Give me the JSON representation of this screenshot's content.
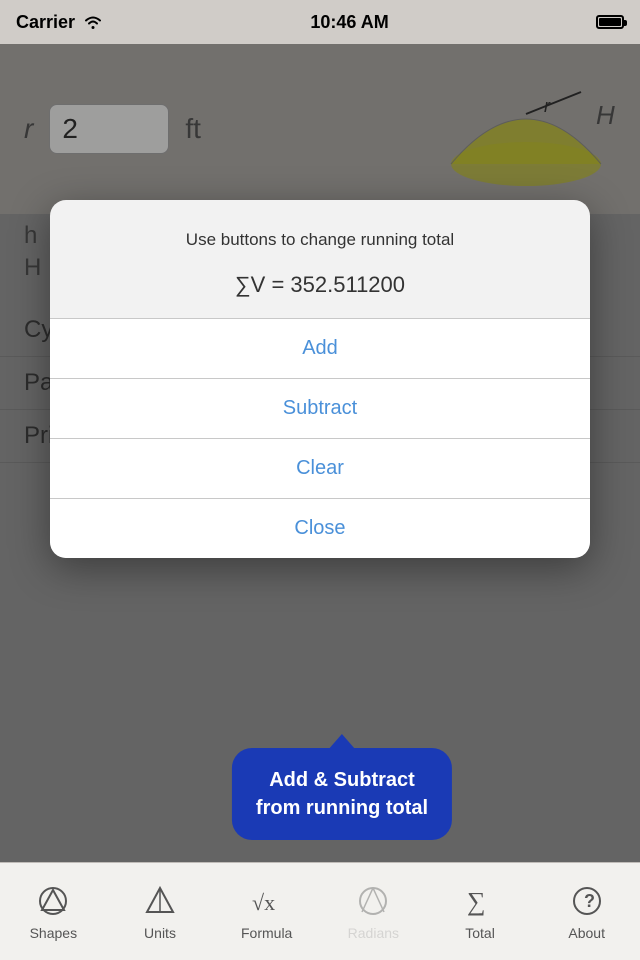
{
  "statusBar": {
    "carrier": "Carrier",
    "time": "10:46 AM"
  },
  "background": {
    "inputLabel": "r",
    "inputValue": "2",
    "unitLabel": "ft",
    "shapeLabel": "H",
    "hLabel": "h",
    "hLabelBig": "H",
    "listItems": [
      "Cylinders",
      "Paraboloid",
      "Prisms"
    ]
  },
  "dialog": {
    "instruction": "Use buttons to change running total",
    "formula": "∑V = 352.511200",
    "buttons": [
      "Add",
      "Subtract",
      "Clear",
      "Close"
    ]
  },
  "speechBubble": {
    "line1": "Add & Subtract",
    "line2": "from running total"
  },
  "tabBar": {
    "items": [
      {
        "id": "shapes",
        "label": "Shapes",
        "icon": "shapes-icon"
      },
      {
        "id": "units",
        "label": "Units",
        "icon": "units-icon"
      },
      {
        "id": "formula",
        "label": "Formula",
        "icon": "formula-icon"
      },
      {
        "id": "radians",
        "label": "Radians",
        "icon": "radians-icon",
        "dimmed": true
      },
      {
        "id": "total",
        "label": "Total",
        "icon": "total-icon"
      },
      {
        "id": "about",
        "label": "About",
        "icon": "about-icon"
      }
    ]
  }
}
